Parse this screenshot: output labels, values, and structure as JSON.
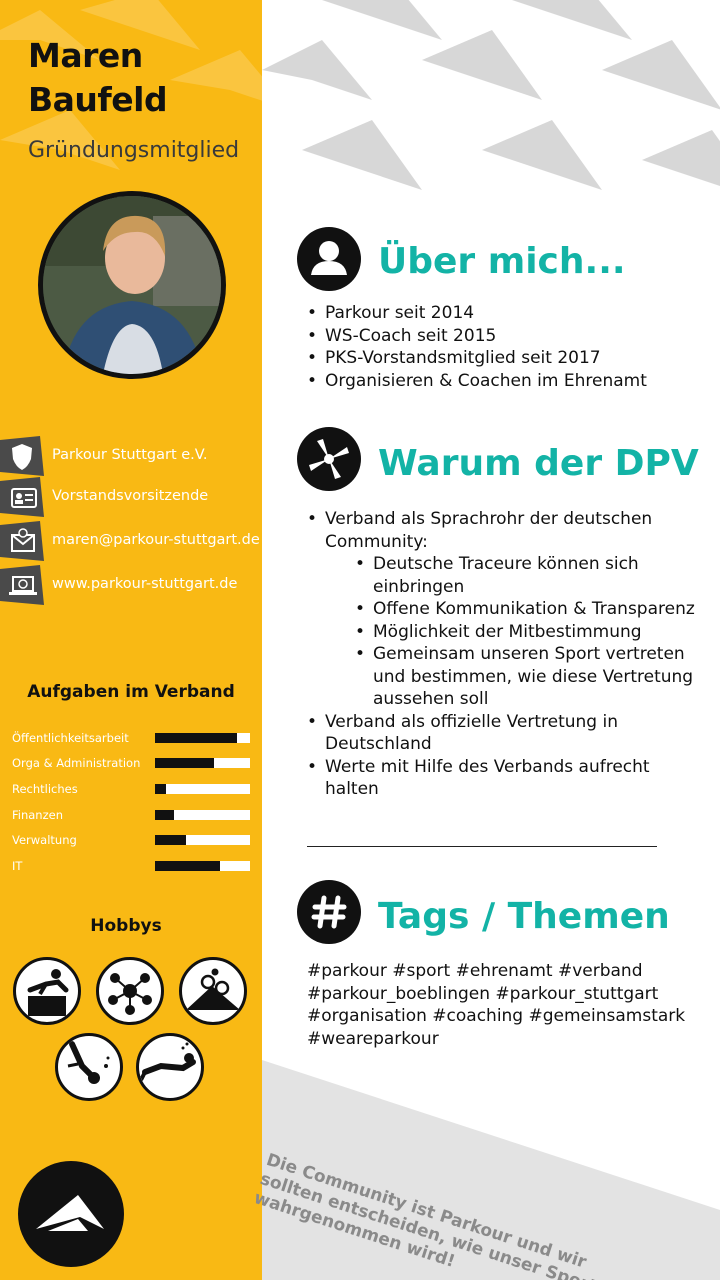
{
  "profile": {
    "first_name": "Maren",
    "last_name": "Baufeld",
    "role": "Gründungsmitglied"
  },
  "info": [
    {
      "icon": "shield-icon",
      "text": "Parkour Stuttgart e.V."
    },
    {
      "icon": "id-card-icon",
      "text": "Vorstandsvorsitzende"
    },
    {
      "icon": "mail-icon",
      "text": "maren@parkour-stuttgart.de"
    },
    {
      "icon": "laptop-globe-icon",
      "text": "www.parkour-stuttgart.de"
    }
  ],
  "tasks": {
    "title": "Aufgaben im Verband",
    "items": [
      {
        "label": "Öffentlichkeitsarbeit",
        "level": 0.86
      },
      {
        "label": "Orga & Administration",
        "level": 0.62
      },
      {
        "label": "Rechtliches",
        "level": 0.12
      },
      {
        "label": "Finanzen",
        "level": 0.2
      },
      {
        "label": "Verwaltung",
        "level": 0.33
      },
      {
        "label": "IT",
        "level": 0.68
      }
    ]
  },
  "hobbys": {
    "title": "Hobbys",
    "icons": [
      "parkour-vault-icon",
      "network-icon",
      "mountain-bike-icon",
      "diving-icon",
      "snorkeling-icon"
    ]
  },
  "about": {
    "title": "Über mich...",
    "items": [
      "Parkour seit 2014",
      "WS-Coach seit 2015",
      "PKS-Vorstandsmitglied seit 2017",
      "Organisieren & Coachen im Ehrenamt"
    ]
  },
  "why": {
    "title": "Warum der DPV",
    "item1": "Verband als Sprachrohr der deutschen Community:",
    "sub": [
      "Deutsche Traceure können sich einbringen",
      "Offene Kommunikation & Transparenz",
      "Möglichkeit der Mitbestimmung",
      "Gemeinsam unseren Sport vertreten und bestimmen, wie diese Vertretung aussehen soll"
    ],
    "item2": "Verband als offizielle Vertretung in Deutschland",
    "item3": "Werte mit Hilfe des Verbands aufrecht halten"
  },
  "tags": {
    "title": "Tags / Themen",
    "text": "#parkour #sport #ehrenamt #verband #parkour_boeblingen #parkour_stuttgart #organisation #coaching #gemeinsamstark #weareparkour"
  },
  "quote": "Die Community ist Parkour und wir sollten entscheiden, wie unser Sport wahrgenommen wird!",
  "colors": {
    "accent_yellow": "#f9b914",
    "heading_teal": "#13b3a6",
    "dark": "#111111"
  }
}
